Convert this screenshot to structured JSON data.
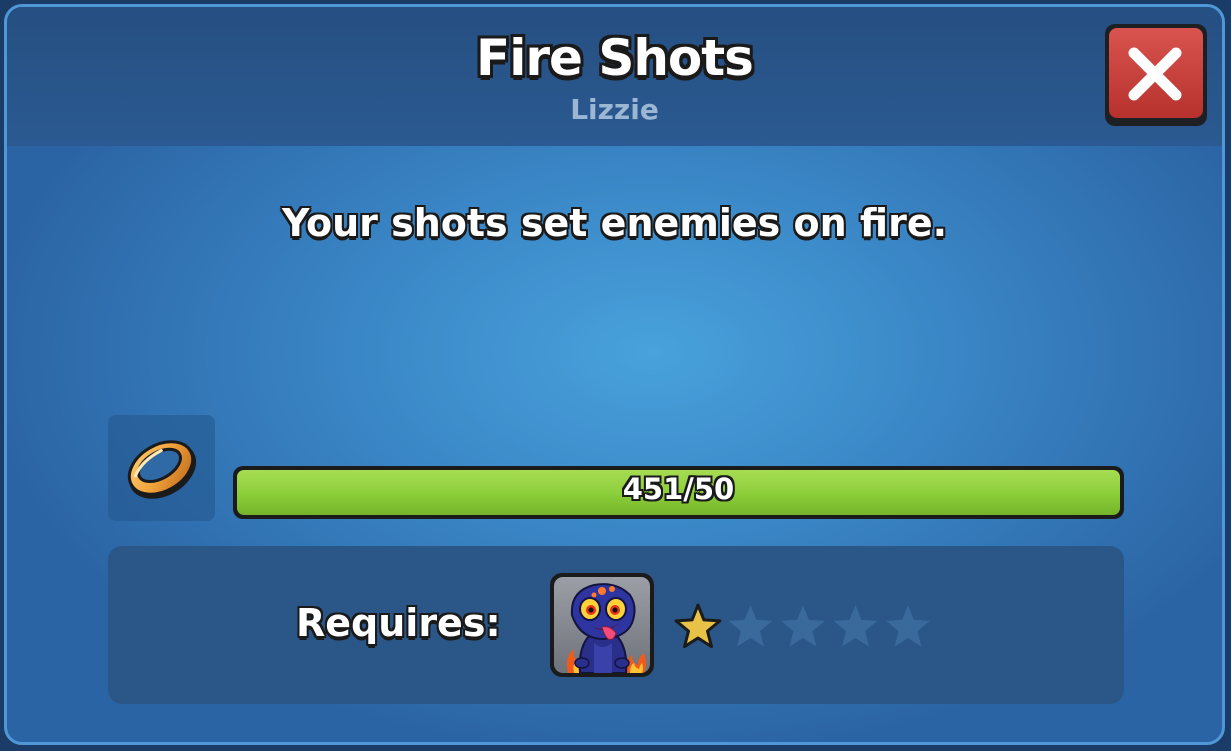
{
  "header": {
    "title": "Fire Shots",
    "subtitle": "Lizzie"
  },
  "close_button": {
    "icon": "close-icon",
    "color": "#c9403c"
  },
  "description": "Your shots set enemies on fire.",
  "progress": {
    "item_icon": "ring-icon",
    "label": "451/50",
    "current": 451,
    "required": 50,
    "fill_fraction": 1.0,
    "fill_color": "#8ccd3a"
  },
  "requires": {
    "label": "Requires:",
    "hero_portrait_icon": "lizzie-portrait-icon",
    "stars_total": 5,
    "stars_filled": 1,
    "filled_star_color": "#e8c246",
    "empty_star_color": "#3a6a9c"
  }
}
